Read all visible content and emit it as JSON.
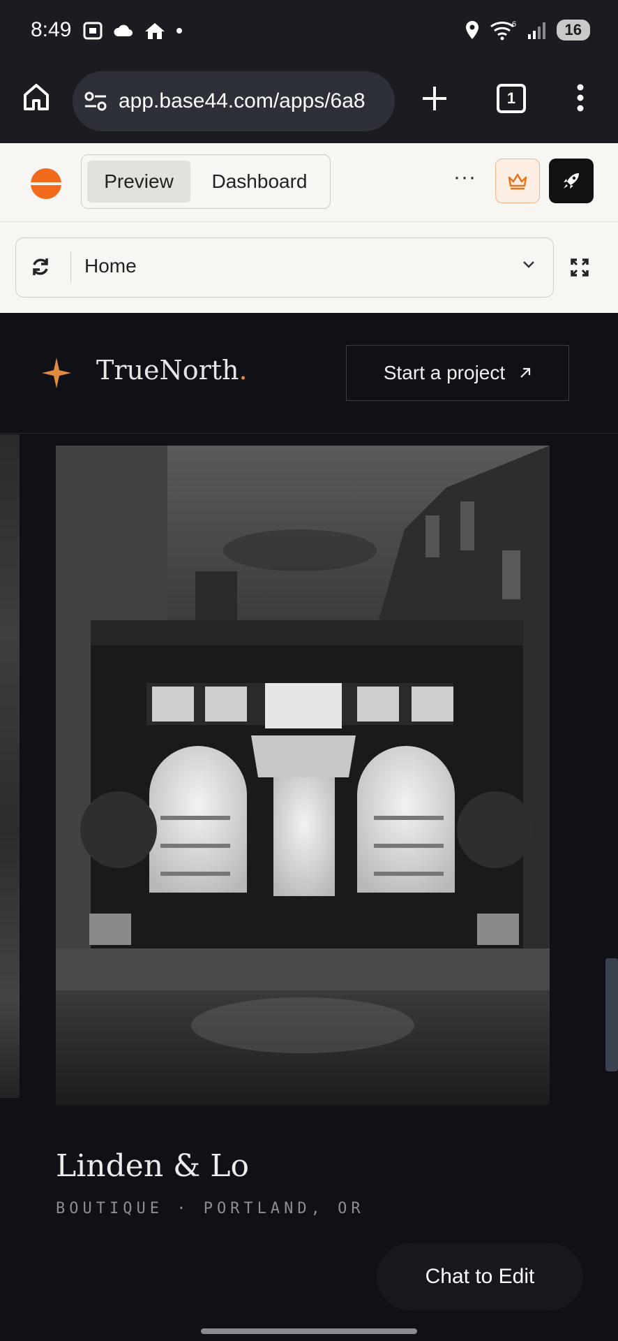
{
  "status_bar": {
    "time": "8:49",
    "battery": "16",
    "wifi_badge": "6"
  },
  "browser": {
    "url": "app.base44.com/apps/6a8",
    "tab_count": "1"
  },
  "app_toolbar": {
    "tabs": [
      {
        "label": "Preview",
        "active": true
      },
      {
        "label": "Dashboard",
        "active": false
      }
    ],
    "more_label": "···",
    "accent_color": "#f26a1b"
  },
  "page_selector": {
    "current_page": "Home"
  },
  "site": {
    "brand_name": "TrueNorth",
    "brand_suffix": ".",
    "cta_label": "Start a project",
    "project_title": "Linden & Lo",
    "project_meta": "BOUTIQUE · PORTLAND, OR"
  },
  "chat_button": {
    "label": "Chat to Edit"
  }
}
